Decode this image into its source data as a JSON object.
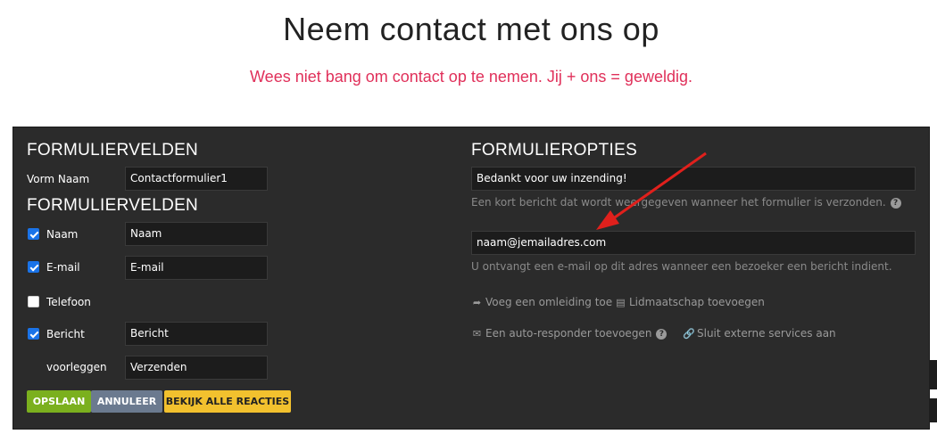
{
  "header": {
    "title": "Neem contact met ons op",
    "subtitle": "Wees niet bang om contact op te nemen. Jij + ons = geweldig."
  },
  "fields_section": {
    "heading": "FORMULIERVELDEN",
    "form_name_label": "Vorm Naam",
    "form_name_value": "Contactformulier1",
    "fields_heading": "FORMULIERVELDEN",
    "fields": [
      {
        "label": "Naam",
        "checked": true,
        "value": "Naam"
      },
      {
        "label": "E-mail",
        "checked": true,
        "value": "E-mail"
      },
      {
        "label": "Telefoon",
        "checked": false,
        "value": ""
      },
      {
        "label": "Bericht",
        "checked": true,
        "value": "Bericht"
      }
    ],
    "submit_label": "voorleggen",
    "submit_value": "Verzenden"
  },
  "buttons": {
    "save": "OPSLAAN",
    "cancel": "ANNULEER",
    "view_reactions": "BEKIJK ALLE REACTIES"
  },
  "options_section": {
    "heading": "FORMULIEROPTIES",
    "thanks_value": "Bedankt voor uw inzending!",
    "thanks_help": "Een kort bericht dat wordt weergegeven wanneer het formulier is verzonden.",
    "email_value": "naam@jemailadres.com",
    "email_help": "U ontvangt een e-mail op dit adres wanneer een bezoeker een bericht indient.",
    "links": {
      "redirect": "Voeg een omleiding toe",
      "membership": "Lidmaatschap toevoegen",
      "autoresponder": "Een auto-responder toevoegen",
      "external": "Sluit externe services aan"
    }
  },
  "icons": {
    "help": "question-circle-icon",
    "redirect": "share-arrow-icon",
    "membership": "id-card-icon",
    "autoresponder": "envelope-icon",
    "external": "link-icon"
  },
  "colors": {
    "subtitle": "#e0305a",
    "panel": "#2b2b2b",
    "save": "#7bb01e",
    "cancel": "#6b7a8f",
    "reactions": "#f2c12e",
    "checkbox": "#1a73e8",
    "annotation_arrow": "#e0201c"
  }
}
